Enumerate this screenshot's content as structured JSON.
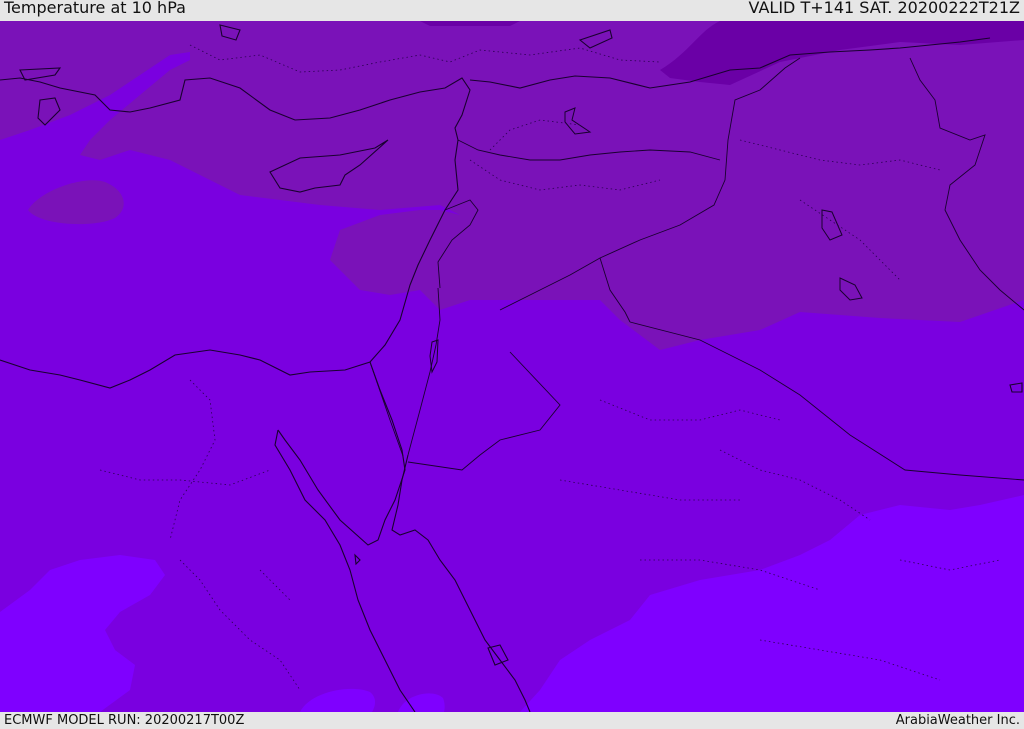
{
  "header": {
    "title": "Temperature at 10 hPa",
    "valid_time": "VALID T+141 SAT. 20200222T21Z"
  },
  "footer": {
    "model_run": "ECMWF MODEL RUN: 20200217T00Z",
    "credit": "ArabiaWeather Inc."
  },
  "colors": {
    "band_coldest": "#6a00a6",
    "band_cold": "#7a12b8",
    "band_mid": "#7a00e0",
    "band_warm": "#7f00ff",
    "outline": "#1a0030"
  }
}
